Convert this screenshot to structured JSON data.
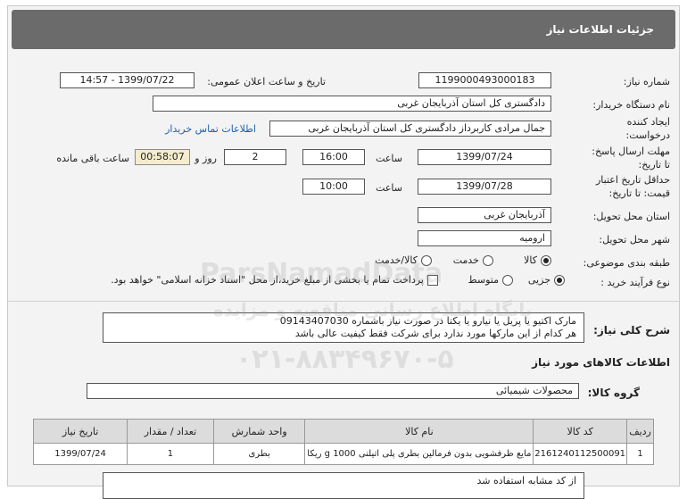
{
  "header": {
    "title": "جزئیات اطلاعات نیاز"
  },
  "fields": {
    "need_number_label": "شماره نیاز:",
    "need_number": "1199000493000183",
    "announce_label": "تاریخ و ساعت اعلان عمومی:",
    "announce_value": "1399/07/22 - 14:57",
    "buyer_label": "نام دستگاه خریدار:",
    "buyer_value": "دادگستری کل استان آذربایجان غربی",
    "creator_label_1": "ایجاد کننده",
    "creator_label_2": "درخواست:",
    "creator_value": "جمال مرادی کاربرداز دادگستری کل استان آذربایجان غربی",
    "contact_link": "اطلاعات تماس خریدار",
    "deadline_label_1": "مهلت ارسال پاسخ:",
    "deadline_label_2": "تا تاریخ:",
    "deadline_date": "1399/07/24",
    "time_label": "ساعت",
    "deadline_time": "16:00",
    "days_value": "2",
    "days_label": "روز و",
    "remaining_value": "00:58:07",
    "remaining_label": "ساعت باقی مانده",
    "validity_label_1": "حداقل تاریخ اعتبار",
    "validity_label_2": "قیمت: تا تاریخ:",
    "validity_date": "1399/07/28",
    "validity_time": "10:00",
    "province_label": "استان محل تحویل:",
    "province_value": "آذربایجان غربی",
    "city_label": "شهر محل تحویل:",
    "city_value": "ارومیه",
    "category_label": "طبقه بندی موضوعی:",
    "category_options": [
      "کالا",
      "خدمت",
      "کالا/خدمت"
    ],
    "process_label": "نوع فرآیند خرید :",
    "process_options": [
      "جزیی",
      "متوسط"
    ],
    "payment_text": "پرداخت تمام یا بخشی از مبلغ خرید،از محل \"اسناد خزانه اسلامی\" خواهد بود."
  },
  "description": {
    "label": "شرح کلی نیاز:",
    "line1": "مارک اکتیو یا پریل یا  نیارو  یا یکتا در صورت نیاز باشماره 09143407030",
    "line2": "هر کدام از این مارکها مورد ندارد برای شرکت فقط کیفیت عالی باشد"
  },
  "goods_section": {
    "title": "اطلاعات کالاهای مورد نیاز",
    "group_label": "گروه کالا:",
    "group_value": "محصولات شیمیائی"
  },
  "table": {
    "headers": [
      "ردیف",
      "کد کالا",
      "نام کالا",
      "واحد شمارش",
      "تعداد / مقدار",
      "تاریخ نیاز"
    ],
    "rows": [
      [
        "1",
        "2161240112500091",
        "مایع ظرفشویی بدون فرمالین بطری پلی اتیلنی 1000 g ریکا",
        "بطری",
        "1",
        "1399/07/24"
      ]
    ]
  },
  "note": {
    "text": "از کد مشابه استفاده شد"
  },
  "watermark": {
    "line1": "ParsNamadData",
    "line2": "پایگاه اطلاع رسانی مناقصه و مزایده",
    "line3": "۰۲۱-۸۸۳۴۹۶۷۰-۵"
  },
  "colors": {
    "header_bg": "#6b6b6b",
    "panel_bg": "#f3f3f3",
    "remaining_bg": "#f4eccd",
    "link": "#1a5fb4"
  }
}
